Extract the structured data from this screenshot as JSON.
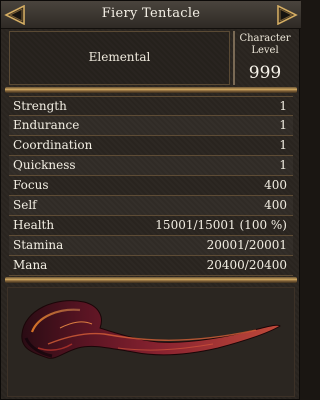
{
  "window": {
    "title": "Fiery Tentacle",
    "left_icon": "chevron-left-arrow-icon",
    "right_icon": "chevron-right-arrow-icon"
  },
  "header": {
    "race": "Elemental",
    "level_caption": "Character Level",
    "level_caption_line1": "Character",
    "level_caption_line2": "Level",
    "level_value": "999"
  },
  "stats": [
    {
      "name": "Strength",
      "value": "1"
    },
    {
      "name": "Endurance",
      "value": "1"
    },
    {
      "name": "Coordination",
      "value": "1"
    },
    {
      "name": "Quickness",
      "value": "1"
    },
    {
      "name": "Focus",
      "value": "400"
    },
    {
      "name": "Self",
      "value": "400"
    },
    {
      "name": "Health",
      "value": "15001/15001 (100 %)"
    },
    {
      "name": "Stamina",
      "value": "20001/20001"
    },
    {
      "name": "Mana",
      "value": "20400/20400"
    }
  ],
  "portrait": {
    "subject": "fiery-tentacle-creature-icon"
  },
  "colors": {
    "panel_background": "#2a2520",
    "gold_trim": "#d2aa62",
    "text": "#f2efe6",
    "row_divider": "#5e4c35"
  }
}
